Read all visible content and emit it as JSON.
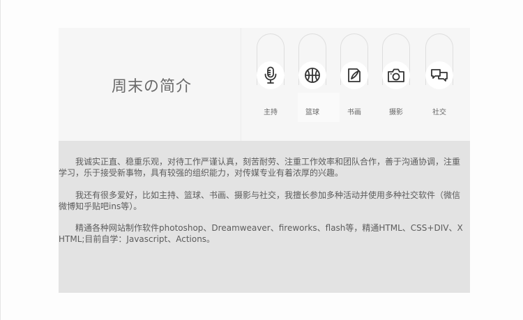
{
  "header": {
    "title": "周末の简介"
  },
  "hobbies": [
    {
      "label": "主持",
      "icon": "microphone-icon"
    },
    {
      "label": "篮球",
      "icon": "basketball-icon"
    },
    {
      "label": "书画",
      "icon": "pen-icon"
    },
    {
      "label": "摄影",
      "icon": "camera-icon"
    },
    {
      "label": "社交",
      "icon": "chat-icon"
    }
  ],
  "intro": {
    "paragraphs": [
      "我诚实正直、稳重乐观，对待工作严谨认真，刻苦耐劳、注重工作效率和团队合作，善于沟通协调，注重学习，乐于接受新事物，具有较强的组织能力，对传媒专业有着浓厚的兴趣。",
      "我还有很多爱好，比如主持、篮球、书画、摄影与社交，我擅长参加多种活动并使用多种社交软件（微信微博知乎贴吧ins等）。",
      "精通各种网站制作软件photoshop、Dreamweaver、fireworks、flash等，精通HTML、CSS+DIV、XHTML;目前自学：Javascript、Actions。"
    ]
  }
}
